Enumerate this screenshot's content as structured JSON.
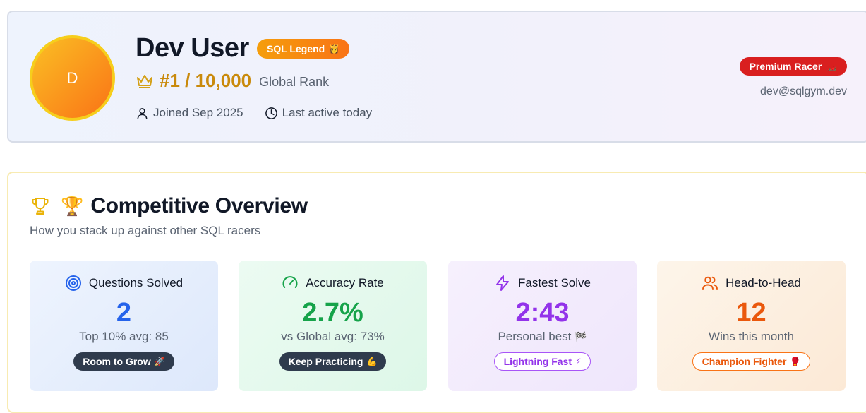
{
  "profile": {
    "avatar_initial": "D",
    "name": "Dev User",
    "title_badge": "SQL Legend",
    "title_badge_emoji": "👸",
    "rank": "#1 / 10,000",
    "rank_label": "Global Rank",
    "joined": "Joined Sep 2025",
    "last_active": "Last active today",
    "tier_badge": "Premium Racer",
    "tier_badge_emoji": "🏎️",
    "email": "dev@sqlgym.dev"
  },
  "overview": {
    "emoji": "🏆",
    "title": "Competitive Overview",
    "subtitle": "How you stack up against other SQL racers",
    "stats": [
      {
        "label": "Questions Solved",
        "value": "2",
        "note": "Top 10% avg: 85",
        "pill": "Room to Grow",
        "pill_emoji": "🚀",
        "icon": "target-icon",
        "color": "#2563eb"
      },
      {
        "label": "Accuracy Rate",
        "value": "2.7%",
        "note": "vs Global avg: 73%",
        "pill": "Keep Practicing",
        "pill_emoji": "💪",
        "icon": "gauge-icon",
        "color": "#16a34a"
      },
      {
        "label": "Fastest Solve",
        "value": "2:43",
        "note": "Personal best",
        "note_emoji": "🏁",
        "pill": "Lightning Fast",
        "pill_emoji": "⚡",
        "icon": "lightning-icon",
        "color": "#9333ea"
      },
      {
        "label": "Head-to-Head",
        "value": "12",
        "note": "Wins this month",
        "pill": "Champion Fighter",
        "pill_emoji": "🥊",
        "icon": "users-icon",
        "color": "#ea580c"
      }
    ]
  },
  "colors": {
    "rank_gold": "#c98a0c",
    "premium_red": "#d91f1f",
    "legend_orange": "#f59e0b"
  }
}
